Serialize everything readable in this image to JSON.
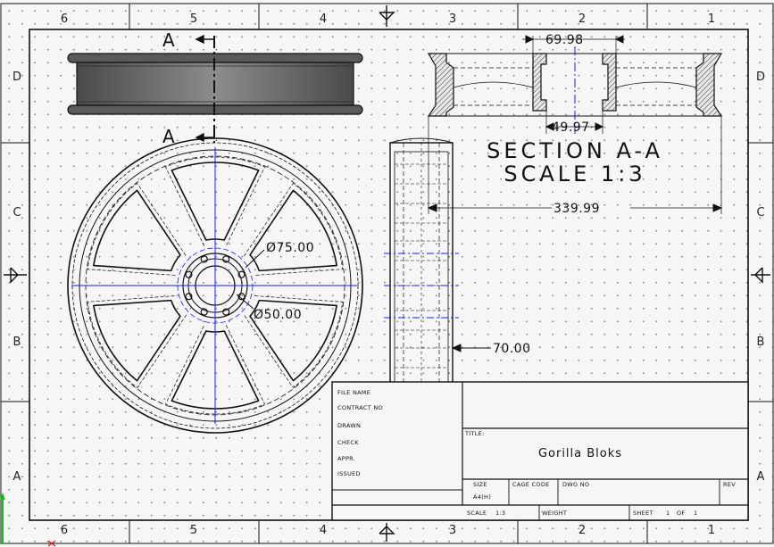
{
  "zones": {
    "columns": [
      "6",
      "5",
      "4",
      "3",
      "2",
      "1"
    ],
    "rows": [
      "D",
      "C",
      "B",
      "A"
    ]
  },
  "section_marks": {
    "top": "A",
    "bottom": "A"
  },
  "section_view": {
    "title": "SECTION A-A",
    "scale": "SCALE 1:3"
  },
  "dimensions": {
    "hub_width": "69.98",
    "hub_inner": "49.97",
    "overall": "339.99",
    "bolt_circle": "Ø75.00",
    "center_bore": "Ø50.00",
    "side_width": "70.00"
  },
  "title_block": {
    "labels": {
      "file_name": "FILE NAME",
      "contract_no": "CONTRACT NO",
      "drawn": "DRAWN",
      "check": "CHECK",
      "appr": "APPR.",
      "issued": "ISSUED",
      "title": "TITLE:",
      "size": "SIZE",
      "cage_code": "CAGE CODE",
      "dwg_no": "DWG NO",
      "rev": "REV",
      "scale": "SCALE",
      "weight": "WEIGHT",
      "sheet": "SHEET",
      "of": "OF"
    },
    "values": {
      "title": "Gorilla Bloks",
      "size": "A4(H)",
      "scale": "1:3",
      "sheet": "1",
      "of": "1"
    }
  },
  "colors": {
    "line": "#111111",
    "centerline": "#1a1aff",
    "shade": "#6a6a6a",
    "axis_y": "#18c018",
    "axis_x": "#e02020"
  }
}
